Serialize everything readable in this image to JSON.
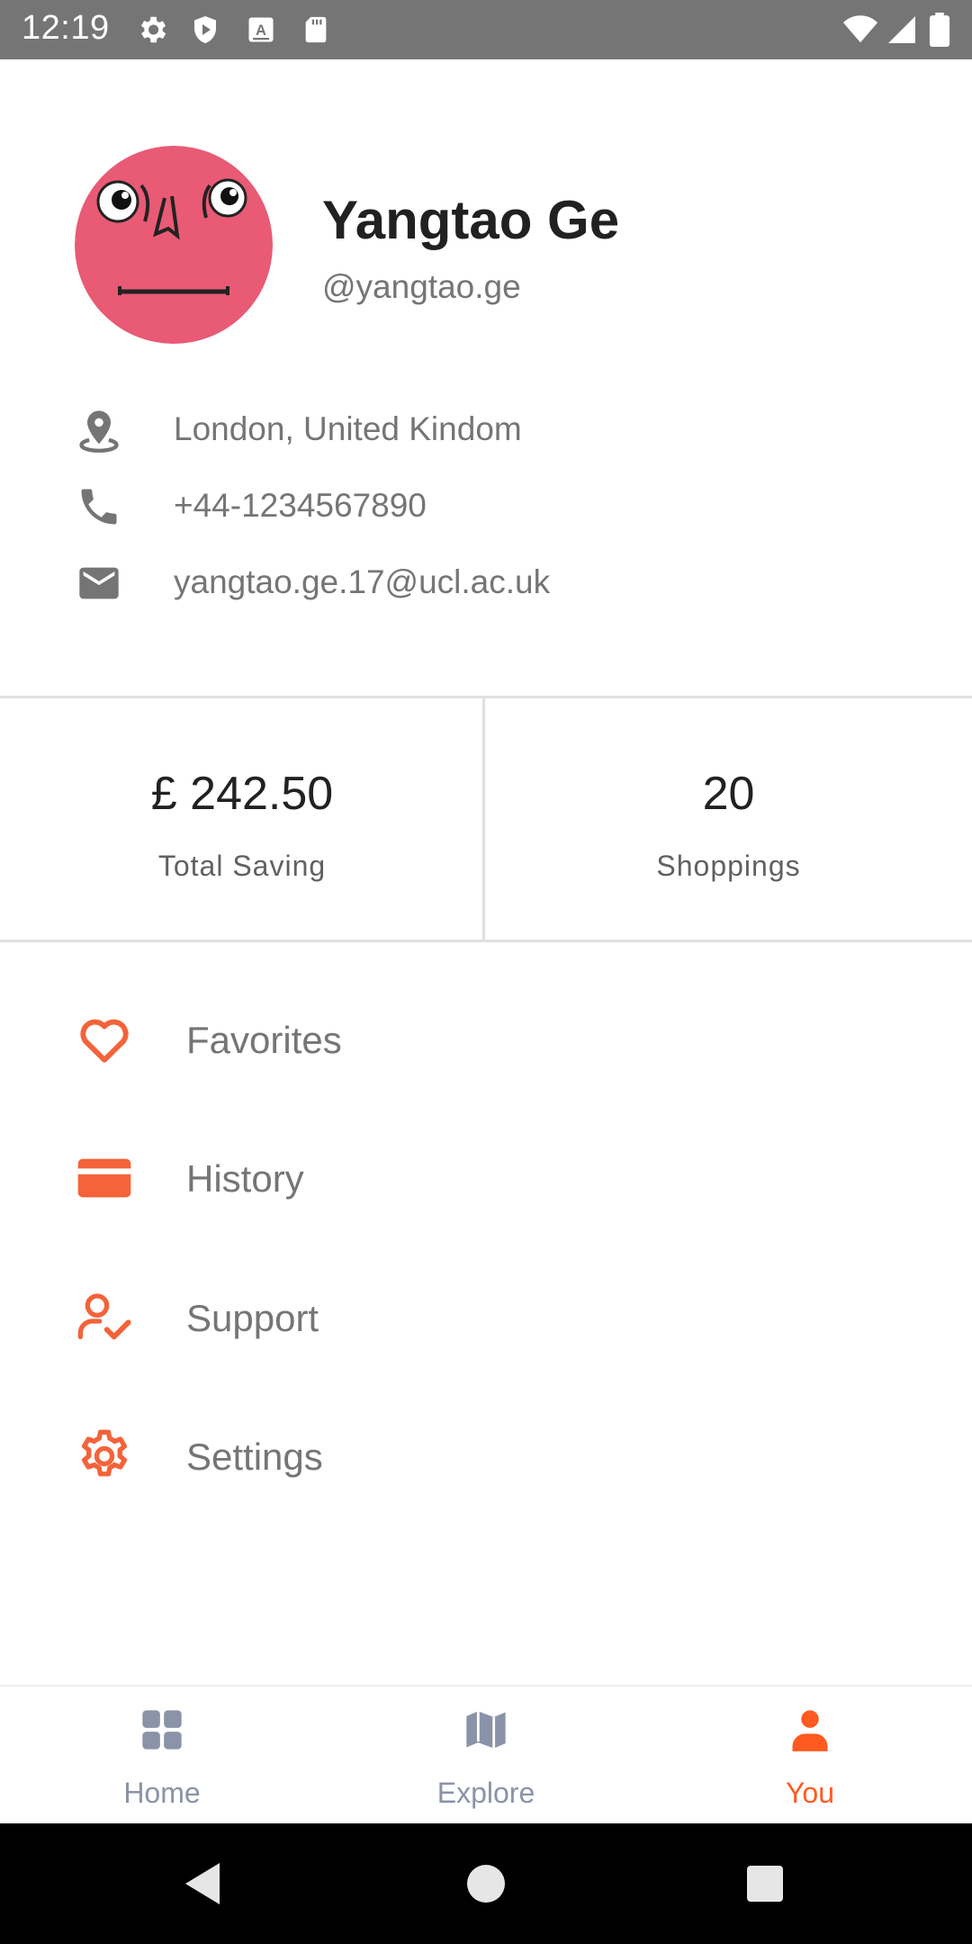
{
  "status_bar": {
    "time": "12:19",
    "icons": [
      "gear-icon",
      "shield-icon",
      "font-icon",
      "sd-card-icon",
      "wifi-icon",
      "signal-icon",
      "battery-icon"
    ]
  },
  "profile": {
    "name": "Yangtao Ge",
    "handle": "@yangtao.ge",
    "avatar_icon": "avatar-face-icon",
    "avatar_color": "#e95a75"
  },
  "contact": {
    "location": "London, United Kindom",
    "phone": "+44-1234567890",
    "email": "yangtao.ge.17@ucl.ac.uk"
  },
  "stats": [
    {
      "value": "£ 242.50",
      "label": "Total Saving"
    },
    {
      "value": "20",
      "label": "Shoppings"
    }
  ],
  "menu": [
    {
      "label": "Favorites",
      "icon": "heart-icon"
    },
    {
      "label": "History",
      "icon": "card-icon"
    },
    {
      "label": "Support",
      "icon": "user-check-icon"
    },
    {
      "label": "Settings",
      "icon": "gear-icon"
    }
  ],
  "bottom_nav": {
    "items": [
      {
        "label": "Home",
        "icon": "grid-icon"
      },
      {
        "label": "Explore",
        "icon": "map-icon"
      },
      {
        "label": "You",
        "icon": "person-icon"
      }
    ],
    "active": "You"
  },
  "colors": {
    "accent": "#ff5a1f",
    "menu_icon": "#f4633a",
    "nav_inactive": "#8a93a8",
    "status_bar": "#757575"
  }
}
